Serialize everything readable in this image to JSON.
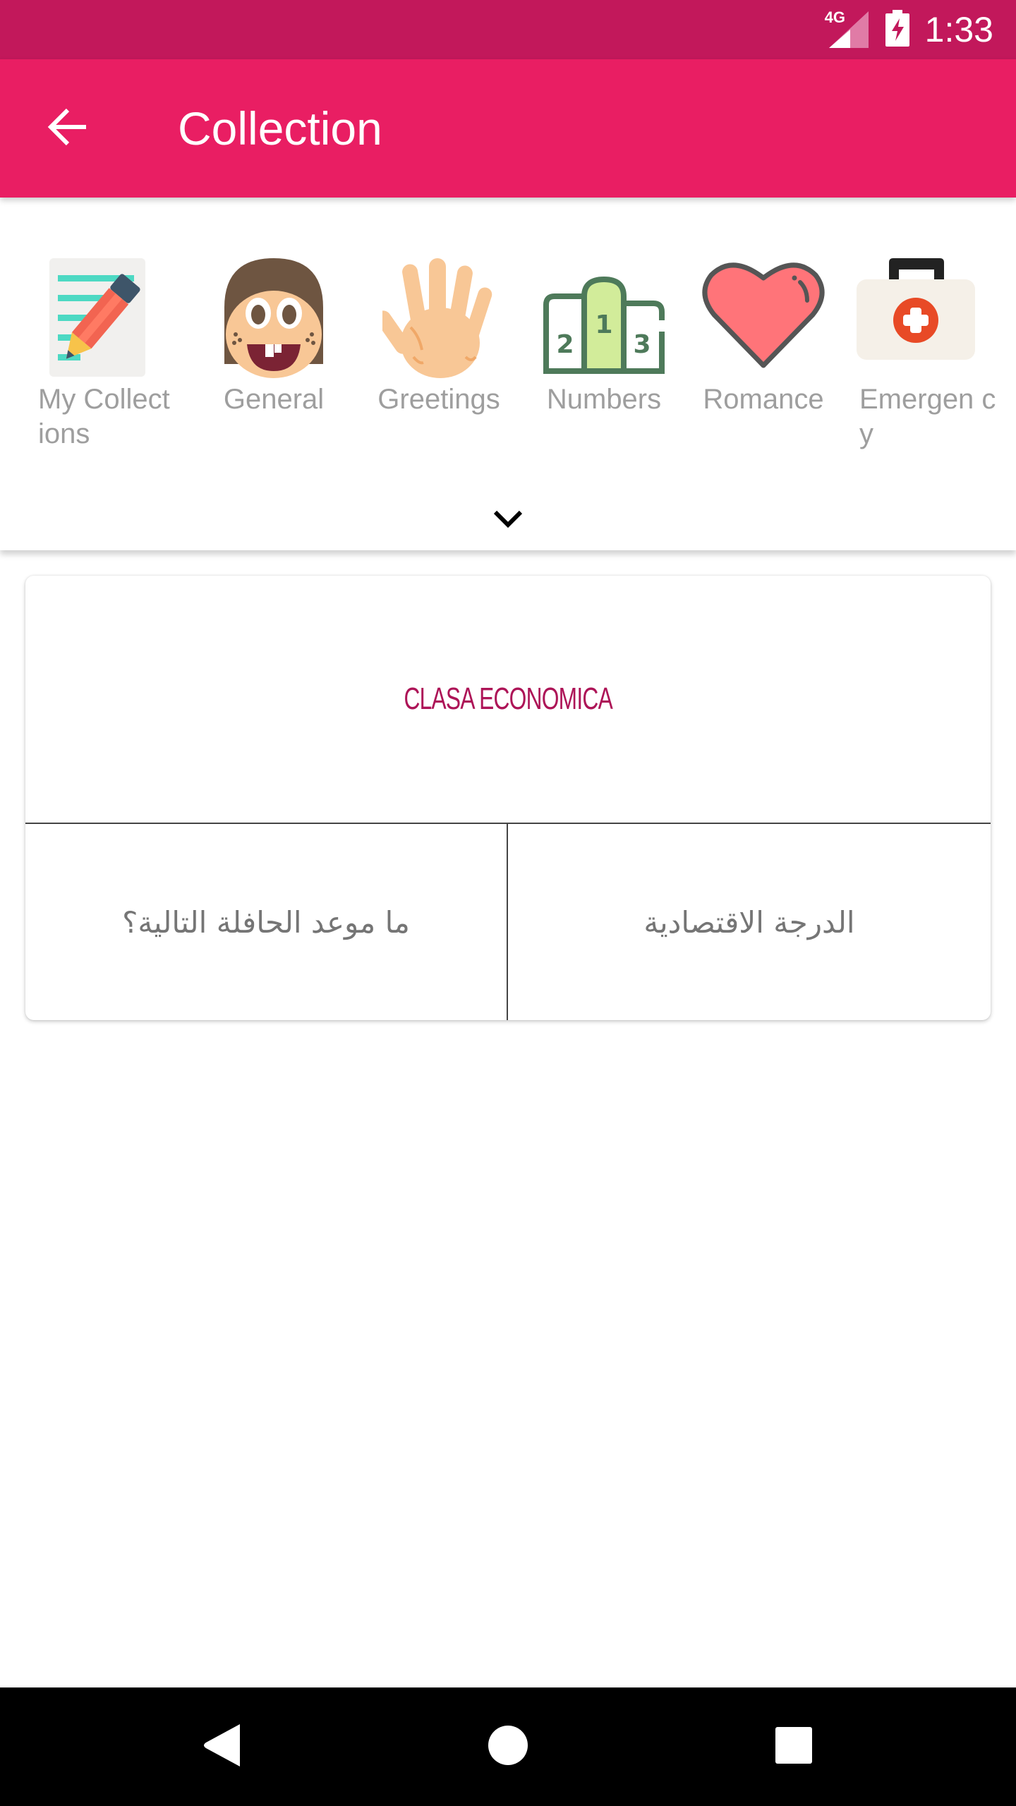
{
  "status_bar": {
    "network": "4G",
    "time": "1:33",
    "icons": [
      "signal-icon",
      "battery-charging-icon"
    ]
  },
  "app_bar": {
    "title": "Collection",
    "back_icon": "arrow-back-icon"
  },
  "categories": [
    {
      "label": "My Collections",
      "icon": "notepad-pencil-icon"
    },
    {
      "label": "General",
      "icon": "face-icon"
    },
    {
      "label": "Greetings",
      "icon": "waving-hand-icon"
    },
    {
      "label": "Numbers",
      "icon": "podium-icon"
    },
    {
      "label": "Romance",
      "icon": "heart-icon"
    },
    {
      "label": "Emergency",
      "icon": "first-aid-kit-icon"
    }
  ],
  "category_labels_wrapped": [
    "My Collect ions",
    "General",
    "Greetings",
    "Numbers",
    "Romance",
    "Emergen cy"
  ],
  "expand_icon": "chevron-down-icon",
  "phrase_card": {
    "title": "CLASA ECONOMICA",
    "cells": [
      {
        "text": "ما موعد الحافلة التالية؟"
      },
      {
        "text": "الدرجة الاقتصادية"
      }
    ]
  },
  "colors": {
    "status_bar": "#C2185B",
    "app_bar": "#E91E63",
    "card_title": "#AD1457",
    "category_label": "#9E9E9E",
    "cell_text": "#757575"
  },
  "nav_bar": {
    "buttons": [
      "back-nav-icon",
      "home-nav-icon",
      "recents-nav-icon"
    ]
  }
}
